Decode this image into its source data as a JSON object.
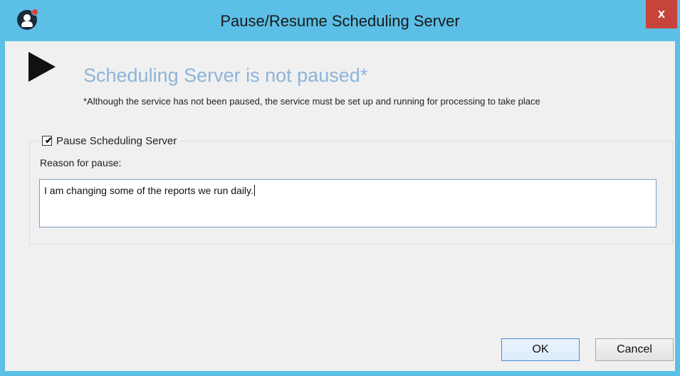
{
  "window": {
    "title": "Pause/Resume Scheduling Server",
    "close_label": "x"
  },
  "status": {
    "title": "Scheduling Server is not paused*",
    "note": "*Although the service has not been paused, the service must be set up and running for processing to take place"
  },
  "pause_group": {
    "checkbox_label": "Pause Scheduling Server",
    "checked": true,
    "reason_label": "Reason for pause:",
    "reason_value": "I am changing some of the reports we run daily."
  },
  "buttons": {
    "ok_label": "OK",
    "cancel_label": "Cancel"
  },
  "icons": {
    "app": "user-avatar-icon",
    "status": "play-icon"
  }
}
